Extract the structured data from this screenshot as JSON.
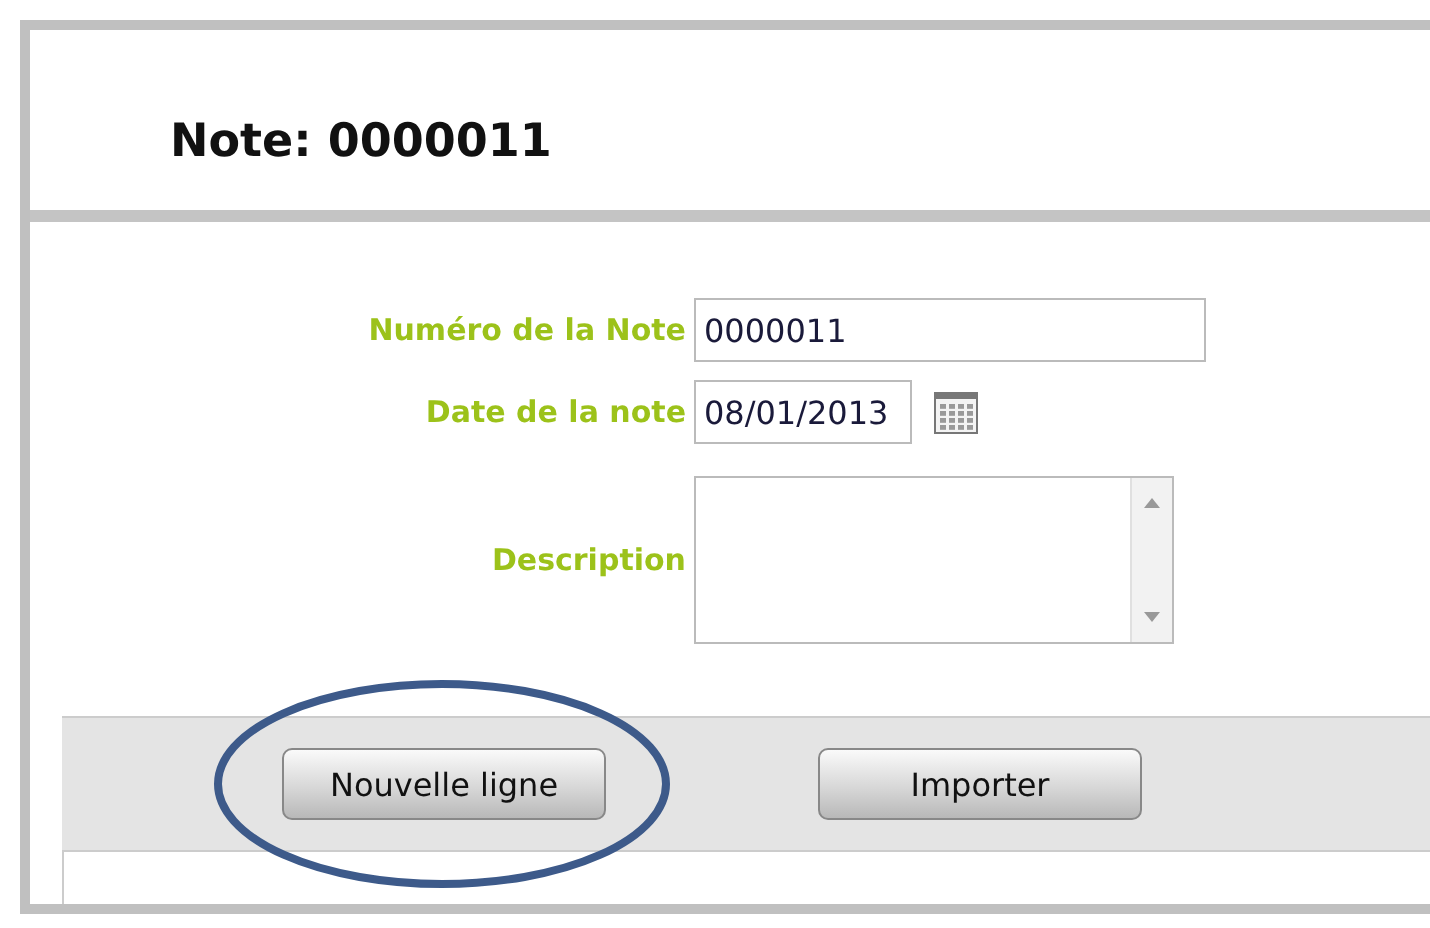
{
  "header": {
    "title": "Note: 0000011"
  },
  "form": {
    "fields": [
      {
        "kind": "text",
        "label": "Numéro de la Note",
        "value": "0000011"
      },
      {
        "kind": "date",
        "label": "Date de la note",
        "value": "08/01/2013"
      },
      {
        "kind": "textarea",
        "label": "Description"
      }
    ]
  },
  "toolbar": {
    "buttons": [
      {
        "kind": "circled",
        "label": "Nouvelle ligne"
      },
      {
        "kind": "plain",
        "label": "Importer"
      }
    ]
  }
}
